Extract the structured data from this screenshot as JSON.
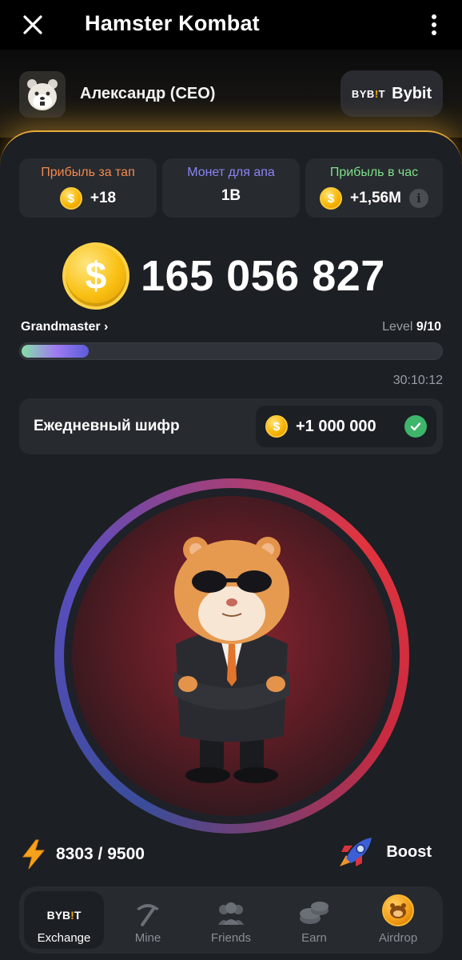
{
  "app": {
    "title": "Hamster Kombat"
  },
  "profile": {
    "name": "Александр (CEO)",
    "exchange_logo": "BYB!T",
    "exchange_name": "Bybit"
  },
  "stats": [
    {
      "label": "Прибыль за тап",
      "value": "+18",
      "color": "#f4894e",
      "has_coin": true
    },
    {
      "label": "Монет для апа",
      "value": "1B",
      "color": "#8b84f4",
      "has_coin": false
    },
    {
      "label": "Прибыль в час",
      "value": "+1,56M",
      "color": "#7fe08a",
      "has_coin": true,
      "info_icon": "i"
    }
  ],
  "balance": "165 056 827",
  "coin_symbol": "$",
  "rank": {
    "name": "Grandmaster",
    "chevron": "›"
  },
  "level": {
    "label": "Level",
    "value": "9/10",
    "progress": 0.16
  },
  "timer": "30:10:12",
  "cipher": {
    "label": "Ежедневный шифр",
    "reward": "+1 000 000",
    "claimed": true
  },
  "energy": {
    "value": "8303 / 9500",
    "icon": "lightning-icon"
  },
  "boost": {
    "label": "Boost",
    "icon": "rocket-icon"
  },
  "nav": [
    {
      "label": "Exchange",
      "icon": "bybit-icon",
      "active": true
    },
    {
      "label": "Mine",
      "icon": "pickaxe-icon",
      "active": false
    },
    {
      "label": "Friends",
      "icon": "friends-icon",
      "active": false
    },
    {
      "label": "Earn",
      "icon": "coins-icon",
      "active": false
    },
    {
      "label": "Airdrop",
      "icon": "airdrop-coin-icon",
      "active": false
    }
  ],
  "colors": {
    "accent": "#e8a93a",
    "coin": "#f9c013",
    "panel": "#1c1f24",
    "card": "#272a2f"
  }
}
